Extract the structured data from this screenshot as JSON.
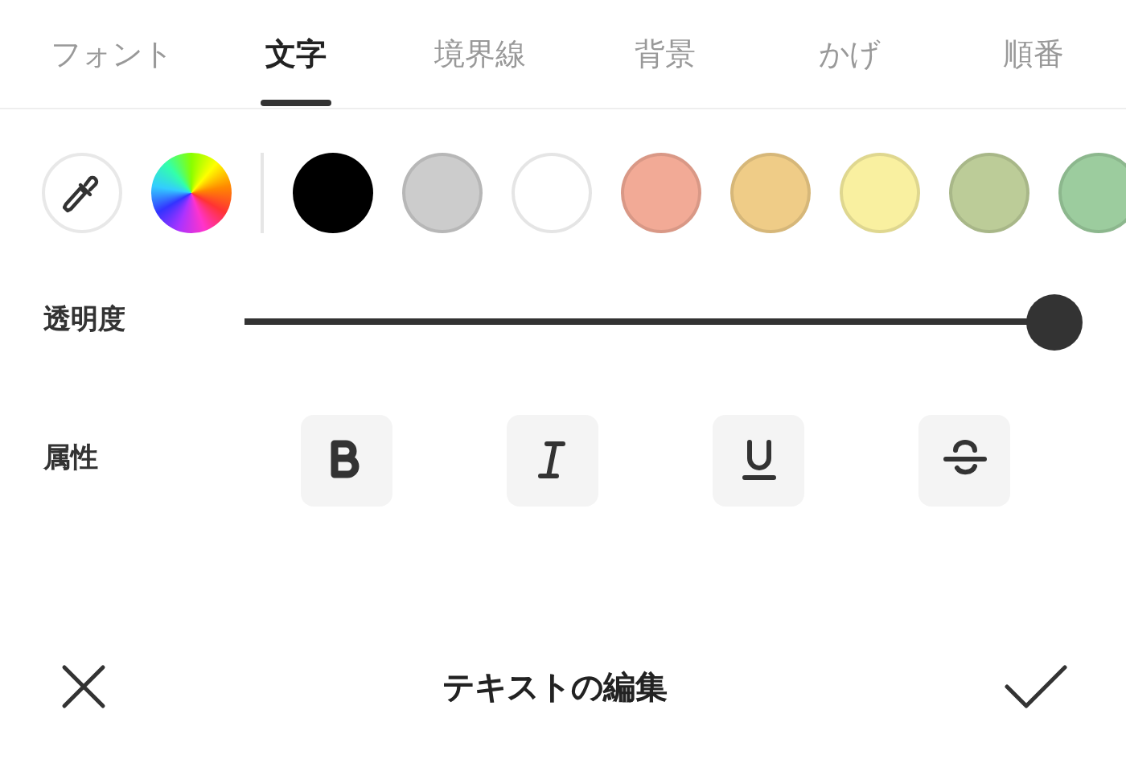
{
  "tabs": [
    {
      "label": "フォント",
      "selected": false
    },
    {
      "label": "文字",
      "selected": true
    },
    {
      "label": "境界線",
      "selected": false
    },
    {
      "label": "背景",
      "selected": false
    },
    {
      "label": "かげ",
      "selected": false
    },
    {
      "label": "順番",
      "selected": false
    }
  ],
  "swatches": [
    {
      "color": "#000000"
    },
    {
      "color": "#cccccc"
    },
    {
      "color": "#ffffff"
    },
    {
      "color": "#f2aa96"
    },
    {
      "color": "#efcc87"
    },
    {
      "color": "#f9f0a0"
    },
    {
      "color": "#bccc98"
    },
    {
      "color": "#9ccc9e"
    }
  ],
  "opacity": {
    "label": "透明度",
    "level": 1
  },
  "attributes": {
    "label": "属性",
    "buttons": [
      {
        "kind": "bold"
      },
      {
        "kind": "italic"
      },
      {
        "kind": "underline"
      },
      {
        "kind": "strikethrough"
      }
    ]
  },
  "footer": {
    "title": "テキストの編集"
  }
}
